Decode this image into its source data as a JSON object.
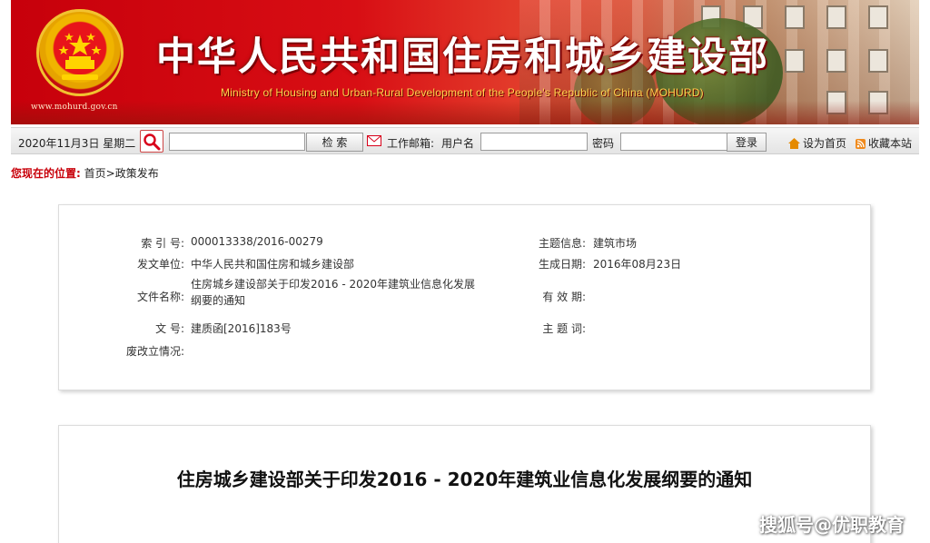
{
  "header": {
    "site_url": "www.mohurd.gov.cn",
    "title": "中华人民共和国住房和城乡建设部",
    "subtitle": "Ministry of Housing and Urban-Rural Development of the People's Republic of China (MOHURD)",
    "emblem_icon": "national-emblem-icon"
  },
  "toolbar": {
    "date": "2020年11月3日 星期二",
    "search_icon": "search-icon",
    "search_value": "",
    "search_button": "检  索",
    "mail_icon": "mail-icon",
    "mail_label": "工作邮箱:",
    "username_label": "用户名",
    "username_value": "",
    "password_label": "密码",
    "password_value": "",
    "login_button": "登录",
    "set_home_label": "设为首页",
    "favorite_label": "收藏本站"
  },
  "breadcrumb": {
    "label": "您现在的位置:",
    "home": "首页",
    "separator": ">",
    "current": "政策发布"
  },
  "info": {
    "index_label": "索 引 号:",
    "index_value": "000013338/2016-00279",
    "issuer_label": "发文单位:",
    "issuer_value": "中华人民共和国住房和城乡建设部",
    "doc_name_label": "文件名称:",
    "doc_name_value": "住房城乡建设部关于印发2016 - 2020年建筑业信息化发展纲要的通知",
    "doc_no_label": "文      号:",
    "doc_no_value": "建质函[2016]183号",
    "revision_label": "废改立情况:",
    "revision_value": "",
    "subject_label": "主题信息:",
    "subject_value": "建筑市场",
    "date_label": "生成日期:",
    "date_value": "2016年08月23日",
    "validity_label": "有 效 期:",
    "validity_value": "",
    "keywords_label": "主 题 词:",
    "keywords_value": ""
  },
  "article": {
    "title": "住房城乡建设部关于印发2016 - 2020年建筑业信息化发展纲要的通知"
  },
  "watermark": "搜狐号@优职教育",
  "colors": {
    "brand_red": "#c8000a",
    "title_gold": "#ffd34d"
  }
}
